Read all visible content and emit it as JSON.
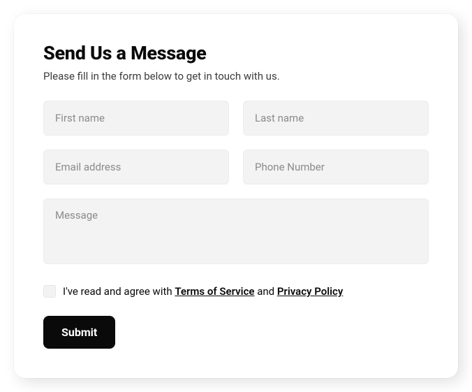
{
  "form": {
    "heading": "Send Us a Message",
    "subheading": "Please fill in the form below to get in touch with us.",
    "fields": {
      "firstName": {
        "placeholder": "First name",
        "value": ""
      },
      "lastName": {
        "placeholder": "Last name",
        "value": ""
      },
      "email": {
        "placeholder": "Email address",
        "value": ""
      },
      "phone": {
        "placeholder": "Phone Number",
        "value": ""
      },
      "message": {
        "placeholder": "Message",
        "value": ""
      }
    },
    "consent": {
      "checked": false,
      "prefix": "I've read and agree with ",
      "terms": "Terms of Service",
      "middle": " and ",
      "privacy": "Privacy Policy"
    },
    "submitLabel": "Submit"
  }
}
